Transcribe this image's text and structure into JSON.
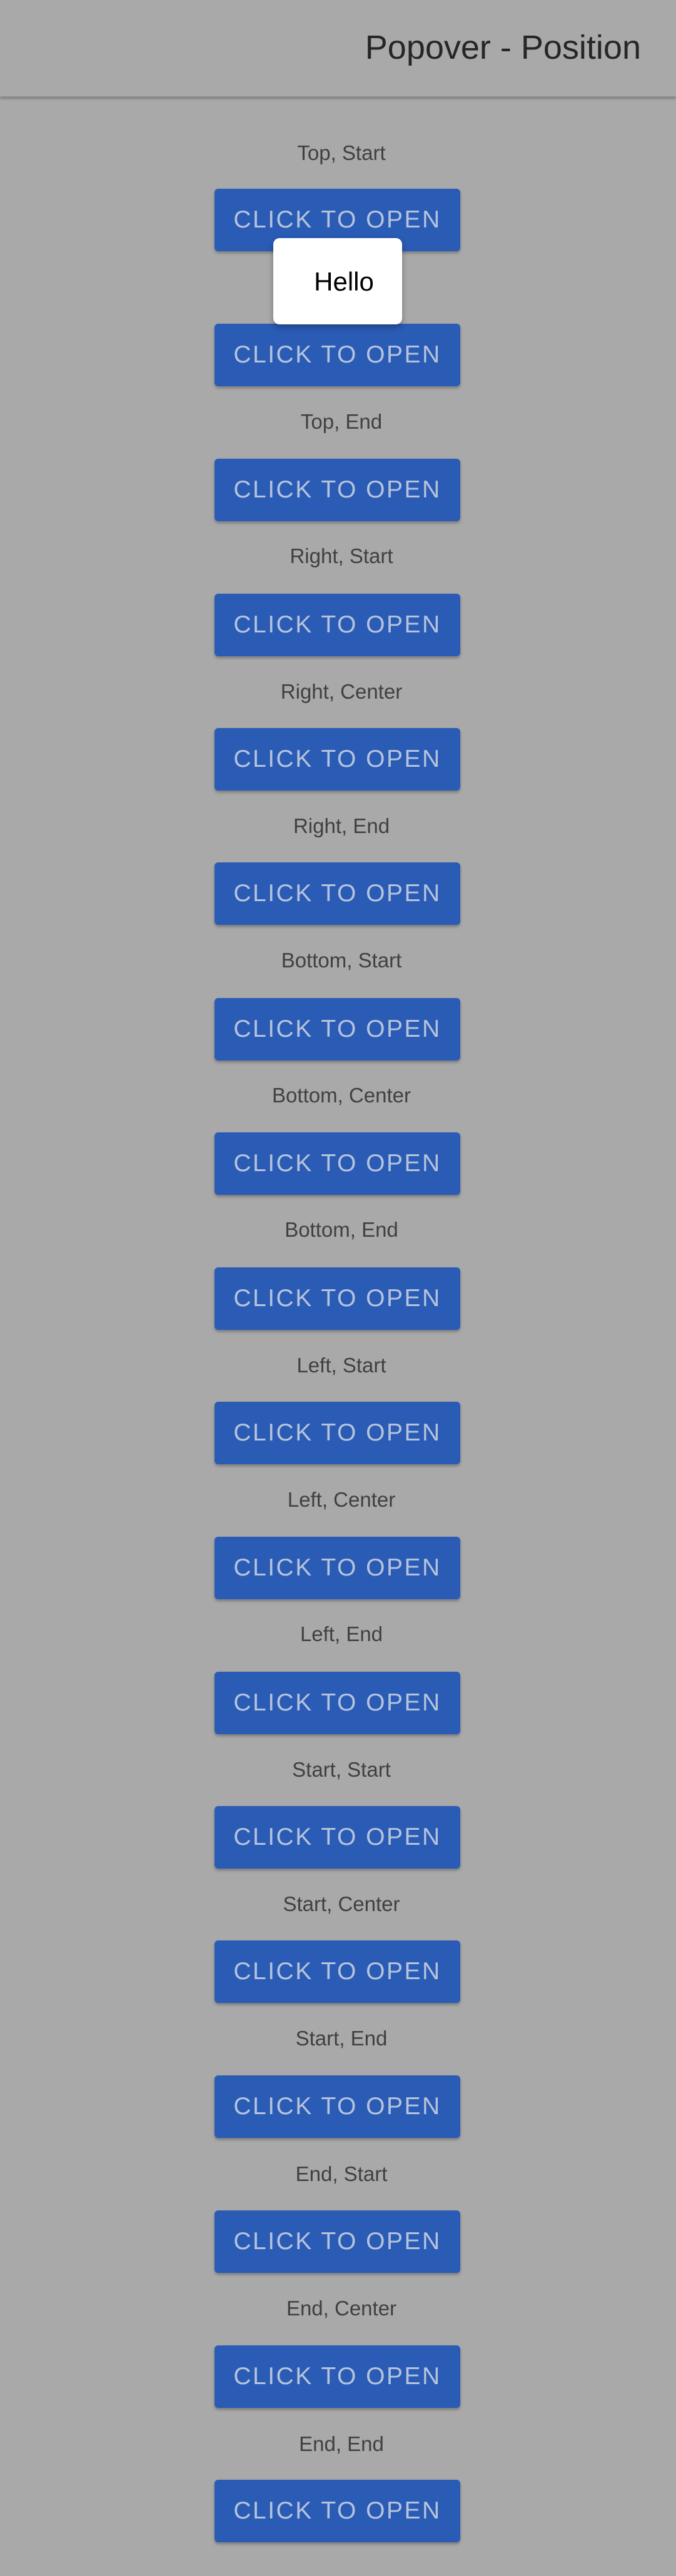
{
  "toolbar": {
    "title": "Popover - Position"
  },
  "button_label": "CLICK TO OPEN",
  "popover": {
    "text": "Hello"
  },
  "labels": [
    "Top, Start",
    "Top, End",
    "Right, Start",
    "Right, Center",
    "Right, End",
    "Bottom, Start",
    "Bottom, Center",
    "Bottom, End",
    "Left, Start",
    "Left, Center",
    "Left, End",
    "Start, Start",
    "Start, Center",
    "Start, End",
    "End, Start",
    "End, Center",
    "End, End"
  ],
  "colors": {
    "background": "#a9a9a9",
    "button": "#2a5bb5",
    "button_text": "#b6c3dc",
    "popover": "#ffffff"
  }
}
